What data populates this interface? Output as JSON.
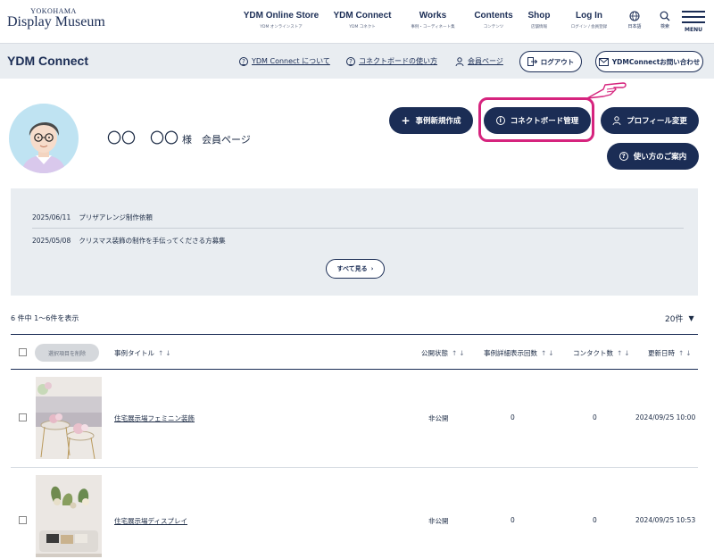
{
  "logo": {
    "small": "YOKOHAMA",
    "big": "Display Museum"
  },
  "nav": [
    {
      "main": "YDM Online Store",
      "sub": "YDM オンラインストア"
    },
    {
      "main": "YDM Connect",
      "sub": "YDM コネクト"
    },
    {
      "main": "Works",
      "sub": "事例・コーディネート集"
    },
    {
      "main": "Contents",
      "sub": "コンテンツ"
    },
    {
      "main": "Shop",
      "sub": "店舗情報"
    },
    {
      "main": "Log In",
      "sub": "ログイン / 会員登録"
    }
  ],
  "nav_icons": {
    "lang": "日本語",
    "search": "検索",
    "menu": "MENU"
  },
  "subheader": {
    "title": "YDM Connect",
    "about": "YDM Connect について",
    "howto": "コネクトボードの使い方",
    "member": "会員ページ",
    "logout": "ログアウト",
    "contact": "YDMConnectお問い合わせ"
  },
  "profile": {
    "name": "〇〇　〇〇",
    "suffix": "様　会員ページ",
    "new_case": "事例新規作成",
    "board": "コネクトボード管理",
    "profile_edit": "プロフィール変更",
    "guide": "使い方のご案内"
  },
  "notices": [
    {
      "date": "2025/06/11",
      "text": "プリザアレンジ制作依頼"
    },
    {
      "date": "2025/05/08",
      "text": "クリスマス装飾の制作を手伝ってくださる方募集"
    }
  ],
  "see_all": "すべて見る",
  "table": {
    "count": "6 件中 1〜6件を表示",
    "per_page": "20件",
    "delete_selected": "選択項目を削除",
    "headers": {
      "title": "事例タイトル",
      "status": "公開状態",
      "views": "事例詳細表示回数",
      "contacts": "コンタクト数",
      "updated": "更新日時"
    },
    "rows": [
      {
        "title": "住宅展示場フェミニン装飾",
        "status": "非公開",
        "views": "0",
        "contacts": "0",
        "updated": "2024/09/25 10:00"
      },
      {
        "title": "住宅展示場ディスプレイ",
        "status": "非公開",
        "views": "0",
        "contacts": "0",
        "updated": "2024/09/25 10:53"
      }
    ]
  },
  "colors": {
    "navy": "#1b2d55",
    "highlight": "#d6247e",
    "subheader_bg": "#e9edf1",
    "avatar_bg": "#bfe3f2"
  }
}
